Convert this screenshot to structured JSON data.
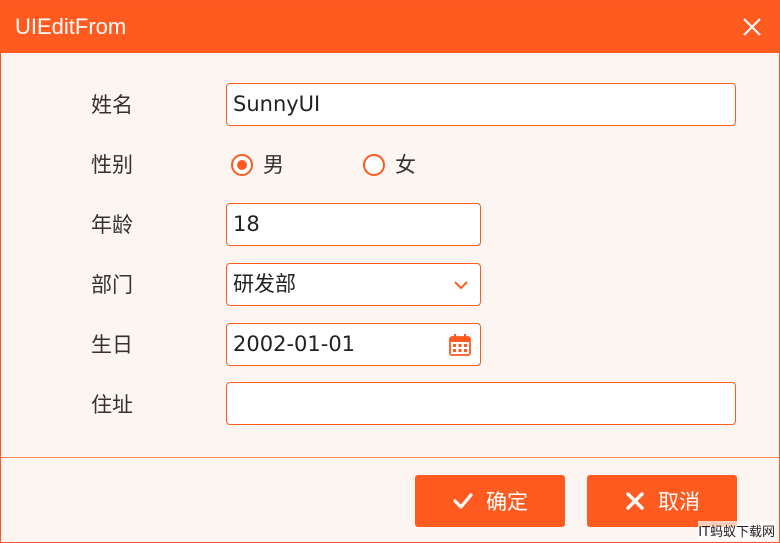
{
  "window": {
    "title": "UIEditFrom"
  },
  "form": {
    "name": {
      "label": "姓名",
      "value": "SunnyUI"
    },
    "gender": {
      "label": "性别",
      "options": [
        {
          "label": "男",
          "checked": true
        },
        {
          "label": "女",
          "checked": false
        }
      ]
    },
    "age": {
      "label": "年龄",
      "value": "18"
    },
    "department": {
      "label": "部门",
      "value": "研发部"
    },
    "birthday": {
      "label": "生日",
      "value": "2002-01-01"
    },
    "address": {
      "label": "住址",
      "value": ""
    }
  },
  "buttons": {
    "ok_label": "确定",
    "cancel_label": "取消"
  },
  "watermark": "IT蚂蚁下载网",
  "colors": {
    "accent": "#ff5a1f",
    "background": "#fdf5f1"
  },
  "icons": {
    "close": "close-icon",
    "dropdown": "chevron-down-icon",
    "calendar": "calendar-icon",
    "ok": "check-icon",
    "cancel": "x-icon"
  }
}
